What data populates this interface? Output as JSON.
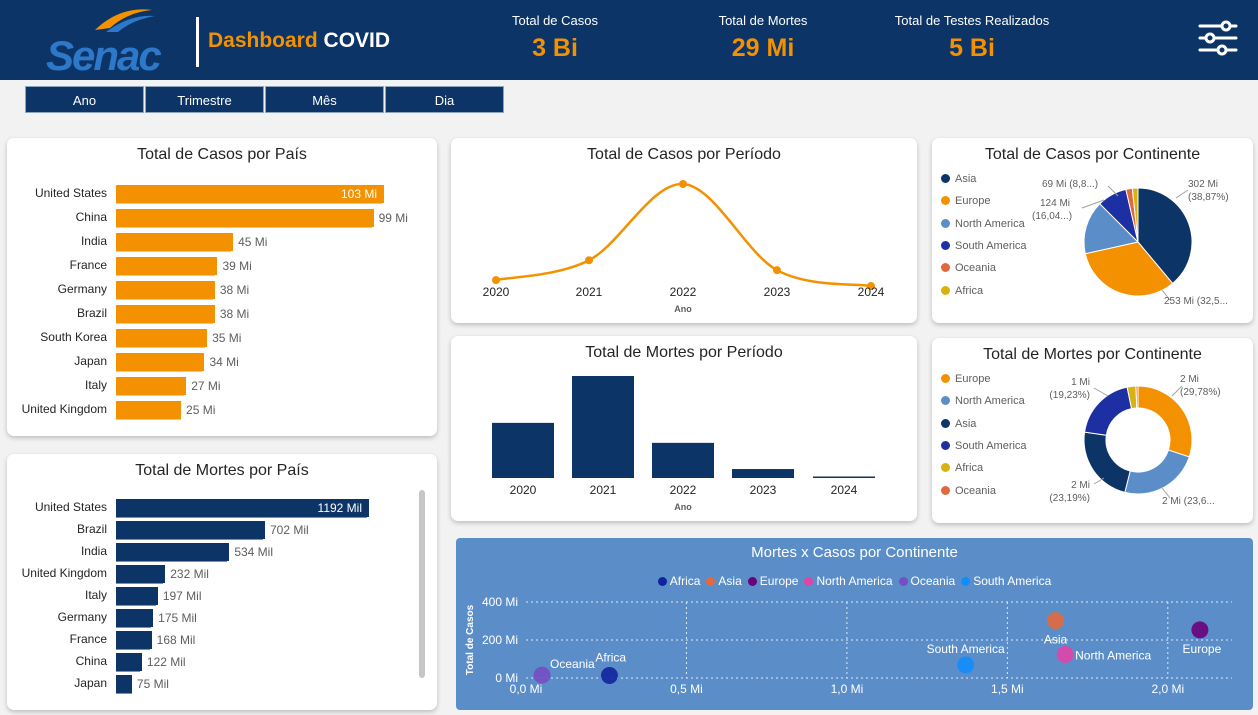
{
  "header": {
    "logo_text": "Senac",
    "title_part1": "Dashboard",
    "title_part2": "COVID",
    "kpis": [
      {
        "label": "Total de Casos",
        "value": "3 Bi"
      },
      {
        "label": "Total de Mortes",
        "value": "29 Mi"
      },
      {
        "label": "Total de Testes Realizados",
        "value": "5 Bi"
      }
    ],
    "filter_icon": "sliders-icon"
  },
  "period_buttons": [
    "Ano",
    "Trimestre",
    "Mês",
    "Dia"
  ],
  "colors": {
    "navy": "#0c3466",
    "orange": "#f39100",
    "asia": "#0c3466",
    "europe": "#f39100",
    "north_america": "#5b8ec9",
    "south_america": "#1c2fa3",
    "oceania": "#e06a3e",
    "africa": "#d8b310"
  },
  "cases_by_country": {
    "title": "Total de Casos por País",
    "countries": [
      "United States",
      "China",
      "India",
      "France",
      "Germany",
      "Brazil",
      "South Korea",
      "Japan",
      "Italy",
      "United Kingdom"
    ],
    "values": [
      103,
      99,
      45,
      39,
      38,
      38,
      35,
      34,
      27,
      25
    ],
    "labels": [
      "103 Mi",
      "99 Mi",
      "45 Mi",
      "39 Mi",
      "38 Mi",
      "38 Mi",
      "35 Mi",
      "34 Mi",
      "27 Mi",
      "25 Mi"
    ]
  },
  "deaths_by_country": {
    "title": "Total de Mortes por País",
    "countries": [
      "United States",
      "Brazil",
      "India",
      "United Kingdom",
      "Italy",
      "Germany",
      "France",
      "China",
      "Japan"
    ],
    "values": [
      1192,
      702,
      534,
      232,
      197,
      175,
      168,
      122,
      75
    ],
    "labels": [
      "1192 Mil",
      "702 Mil",
      "534 Mil",
      "232 Mil",
      "197 Mil",
      "175 Mil",
      "168 Mil",
      "122 Mil",
      "75 Mil"
    ]
  },
  "cases_by_period": {
    "title": "Total de Casos por Período",
    "xlabel": "Ano",
    "chart_data": {
      "type": "line",
      "categories": [
        "2020",
        "2021",
        "2022",
        "2023",
        "2024"
      ],
      "values": [
        80,
        280,
        1050,
        180,
        20
      ],
      "title": "Total de Casos por Período",
      "xlabel": "Ano"
    }
  },
  "deaths_by_period": {
    "title": "Total de Mortes por Período",
    "xlabel": "Ano",
    "chart_data": {
      "type": "bar",
      "categories": [
        "2020",
        "2021",
        "2022",
        "2023",
        "2024"
      ],
      "values": [
        8.0,
        14.8,
        5.1,
        1.3,
        0.1
      ],
      "title": "Total de Mortes por Período",
      "xlabel": "Ano"
    }
  },
  "cases_by_continent": {
    "title": "Total de Casos por Continente",
    "legend": [
      "Asia",
      "Europe",
      "North America",
      "South America",
      "Oceania",
      "Africa"
    ],
    "legend_colors": [
      "#0c3466",
      "#f39100",
      "#5b8ec9",
      "#1c2fa3",
      "#e06a3e",
      "#d8b310"
    ],
    "slices": [
      {
        "name": "Asia",
        "value": 302,
        "color": "#0c3466"
      },
      {
        "name": "Europe",
        "value": 253,
        "color": "#f39100"
      },
      {
        "name": "North America",
        "value": 124,
        "color": "#5b8ec9"
      },
      {
        "name": "South America",
        "value": 69,
        "color": "#1c2fa3"
      },
      {
        "name": "Oceania",
        "value": 15,
        "color": "#e06a3e"
      },
      {
        "name": "Africa",
        "value": 13,
        "color": "#d8b310"
      }
    ],
    "labels": {
      "asia_a": "302 Mi",
      "asia_b": "(38,87%)",
      "europe": "253 Mi (32,5...",
      "na_a": "124 Mi",
      "na_b": "(16,04...)",
      "sa": "69 Mi (8,8...)"
    }
  },
  "deaths_by_continent": {
    "title": "Total de Mortes por Continente",
    "legend": [
      "Europe",
      "North America",
      "Asia",
      "South America",
      "Africa",
      "Oceania"
    ],
    "legend_colors": [
      "#f39100",
      "#5b8ec9",
      "#0c3466",
      "#1c2fa3",
      "#d8b310",
      "#e06a3e"
    ],
    "slices": [
      {
        "name": "Europe",
        "value": 29.78,
        "color": "#f39100"
      },
      {
        "name": "North America",
        "value": 23.6,
        "color": "#5b8ec9"
      },
      {
        "name": "Asia",
        "value": 23.19,
        "color": "#0c3466"
      },
      {
        "name": "South America",
        "value": 19.23,
        "color": "#1c2fa3"
      },
      {
        "name": "Africa",
        "value": 2.6,
        "color": "#d8b310"
      },
      {
        "name": "Oceania",
        "value": 0.6,
        "color": "#e06a3e"
      }
    ],
    "labels": {
      "eu_a": "2 Mi",
      "eu_b": "(29,78%)",
      "na": "2 Mi (23,6...",
      "asia_a": "2 Mi",
      "asia_b": "(23,19%)",
      "sa_a": "1 Mi",
      "sa_b": "(19,23%)"
    }
  },
  "scatter": {
    "title": "Mortes x Casos por Continente",
    "ylabel": "Total de Casos",
    "legend": [
      {
        "name": "Africa",
        "color": "#12239e"
      },
      {
        "name": "Asia",
        "color": "#e06a3e"
      },
      {
        "name": "Europe",
        "color": "#6b007b"
      },
      {
        "name": "North America",
        "color": "#e044a7"
      },
      {
        "name": "Oceania",
        "color": "#744ec2"
      },
      {
        "name": "South America",
        "color": "#118dff"
      }
    ],
    "y_ticks": [
      "400 Mi",
      "200 Mi",
      "0 Mi"
    ],
    "x_ticks": [
      "0,0 Mi",
      "0,5 Mi",
      "1,0 Mi",
      "1,5 Mi",
      "2,0 Mi"
    ],
    "chart_data": {
      "type": "scatter",
      "xlabel": "",
      "ylabel": "Total de Casos",
      "xlim": [
        0,
        2.2
      ],
      "ylim": [
        0,
        400
      ],
      "series": [
        {
          "name": "Africa",
          "x": 0.26,
          "y": 13
        },
        {
          "name": "Asia",
          "x": 1.65,
          "y": 302
        },
        {
          "name": "Europe",
          "x": 2.1,
          "y": 253
        },
        {
          "name": "North America",
          "x": 1.68,
          "y": 124
        },
        {
          "name": "Oceania",
          "x": 0.05,
          "y": 15
        },
        {
          "name": "South America",
          "x": 1.37,
          "y": 69
        }
      ]
    }
  }
}
